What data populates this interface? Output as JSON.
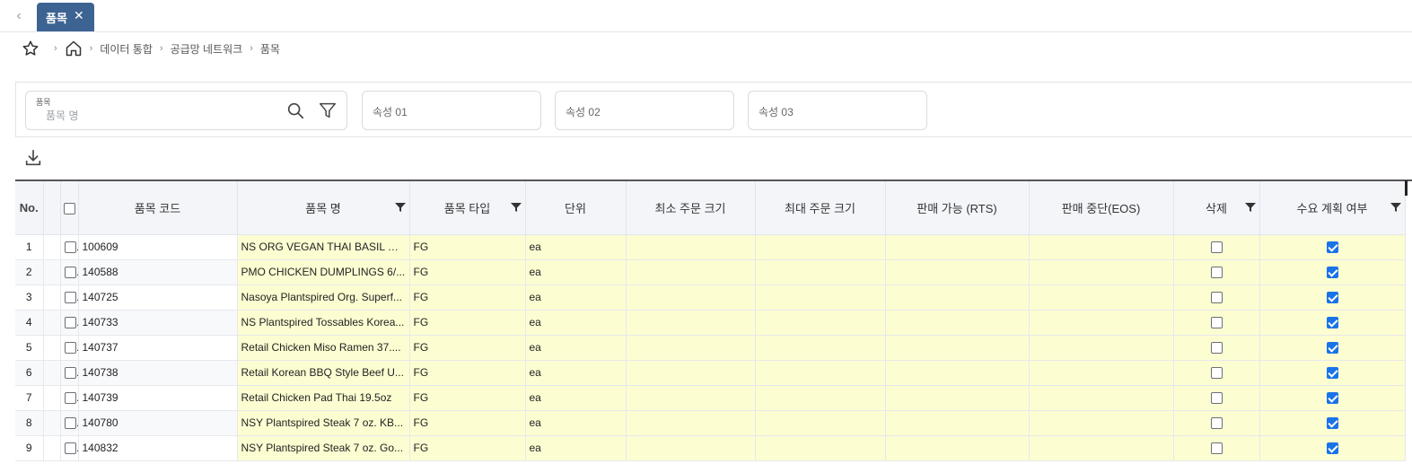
{
  "tabs": [
    {
      "label": "품목"
    }
  ],
  "breadcrumb": [
    "데이터 통합",
    "공급망 네트워크",
    "품목"
  ],
  "search": {
    "item_field_label": "품목",
    "item_field_placeholder": "품목 명",
    "attr1_placeholder": "속성 01",
    "attr2_placeholder": "속성 02",
    "attr3_placeholder": "속성 03"
  },
  "grid": {
    "columns": [
      "No.",
      "",
      "품목 코드",
      "품목 명",
      "품목 타입",
      "단위",
      "최소 주문 크기",
      "최대 주문 크기",
      "판매 가능 (RTS)",
      "판매 중단(EOS)",
      "삭제",
      "수요 계획 여부"
    ],
    "rows": [
      {
        "no": "1",
        "code": "100609",
        "name": "NS ORG VEGAN THAI BASIL VE...",
        "type": "FG",
        "unit": "ea",
        "deleted": false,
        "demand": true
      },
      {
        "no": "2",
        "code": "140588",
        "name": "PMO CHICKEN DUMPLINGS 6/...",
        "type": "FG",
        "unit": "ea",
        "deleted": false,
        "demand": true
      },
      {
        "no": "3",
        "code": "140725",
        "name": "Nasoya Plantspired Org. Superf...",
        "type": "FG",
        "unit": "ea",
        "deleted": false,
        "demand": true
      },
      {
        "no": "4",
        "code": "140733",
        "name": "NS Plantspired Tossables Korea...",
        "type": "FG",
        "unit": "ea",
        "deleted": false,
        "demand": true
      },
      {
        "no": "5",
        "code": "140737",
        "name": "Retail Chicken Miso Ramen 37....",
        "type": "FG",
        "unit": "ea",
        "deleted": false,
        "demand": true
      },
      {
        "no": "6",
        "code": "140738",
        "name": "Retail Korean BBQ Style Beef U...",
        "type": "FG",
        "unit": "ea",
        "deleted": false,
        "demand": true
      },
      {
        "no": "7",
        "code": "140739",
        "name": "Retail Chicken Pad Thai 19.5oz",
        "type": "FG",
        "unit": "ea",
        "deleted": false,
        "demand": true
      },
      {
        "no": "8",
        "code": "140780",
        "name": "NSY Plantspired Steak 7 oz. KB...",
        "type": "FG",
        "unit": "ea",
        "deleted": false,
        "demand": true
      },
      {
        "no": "9",
        "code": "140832",
        "name": "NSY Plantspired Steak 7 oz. Go...",
        "type": "FG",
        "unit": "ea",
        "deleted": false,
        "demand": true
      }
    ]
  },
  "colors": {
    "tab_active": "#3d6392",
    "editable_cell": "#fdfdd2",
    "checkbox_checked": "#1a73e8"
  }
}
